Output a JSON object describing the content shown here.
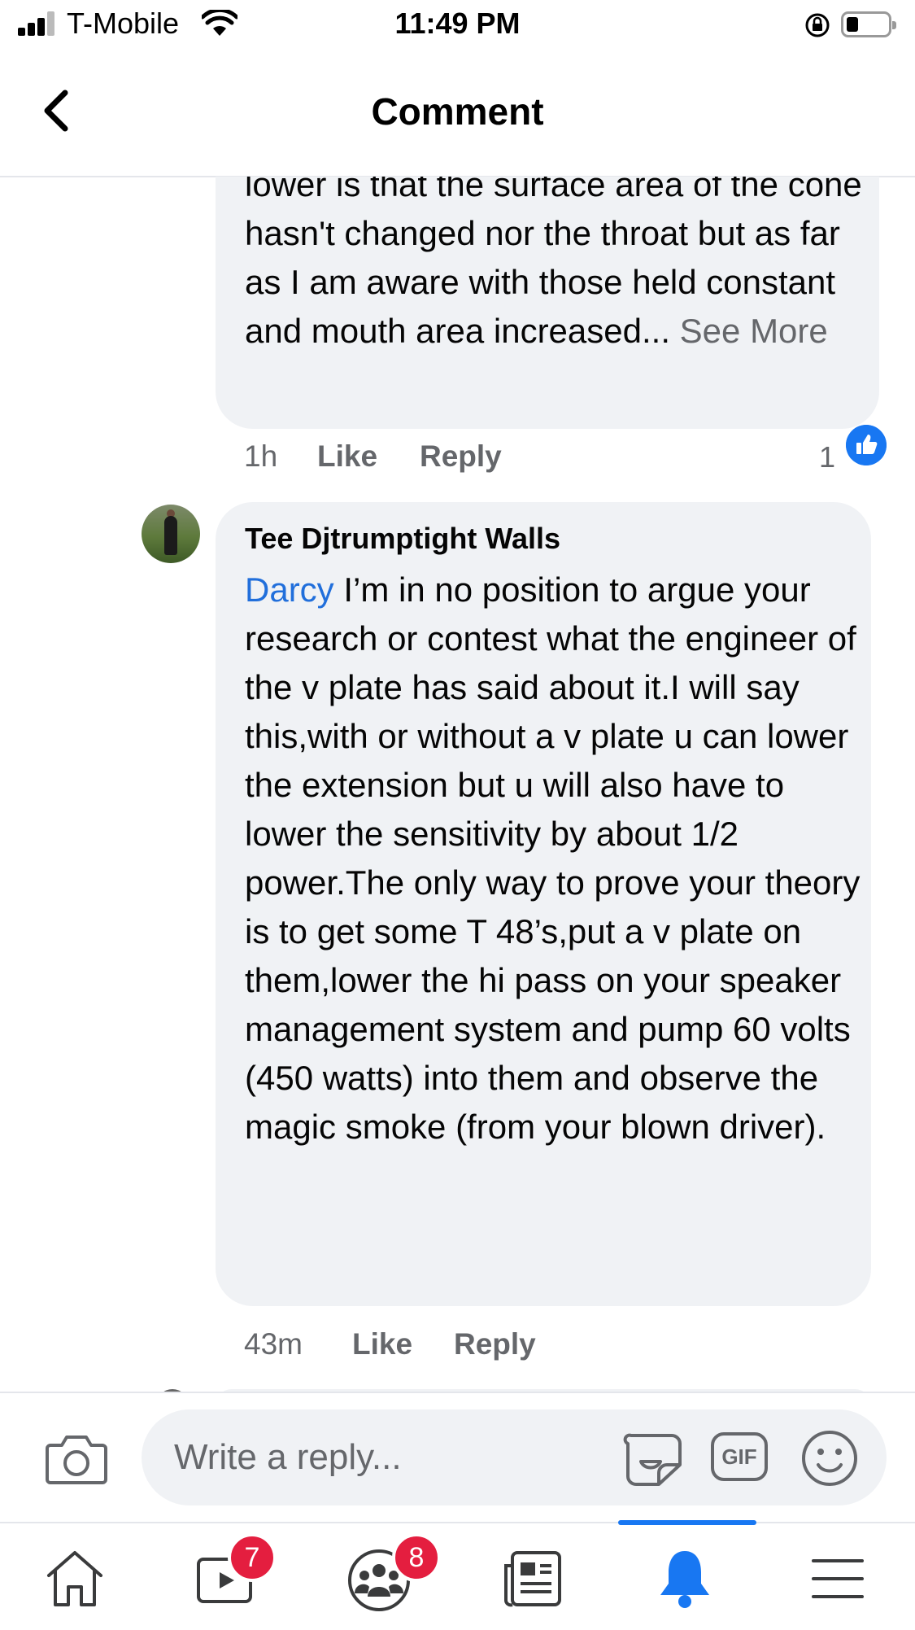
{
  "status_bar": {
    "carrier": "T-Mobile",
    "time": "11:49 PM"
  },
  "header": {
    "title": "Comment"
  },
  "comments": [
    {
      "text": "lower is that the surface area of the cone hasn't changed nor the throat but as far as I am aware with those held constant and mouth area increased...",
      "see_more": "See More",
      "time": "1h",
      "like_label": "Like",
      "reply_label": "Reply",
      "reaction_count": "1"
    },
    {
      "author": "Tee Djtrumptight Walls",
      "mention": "Darcy",
      "text": " I’m in no position to argue your research or contest what the engineer of the v plate has said about it.I will say this,with or without a v plate u can lower the extension but u will also have to lower the sensitivity by about 1/2 power.The only way to prove your theory is to get some T 48’s,put a v plate on them,lower the hi pass on your speaker management system and pump 60 volts (450 watts) into them and observe the magic smoke (from your blown driver).",
      "time": "43m",
      "like_label": "Like",
      "reply_label": "Reply"
    }
  ],
  "composer": {
    "placeholder": "Write a reply...",
    "gif_label": "GIF"
  },
  "tabbar": {
    "watch_badge": "7",
    "groups_badge": "8"
  },
  "colors": {
    "accent": "#1877f2",
    "mention": "#216fdb",
    "badge": "#e41e3f",
    "bubble": "#f0f2f5",
    "secondary_text": "#65676b"
  }
}
